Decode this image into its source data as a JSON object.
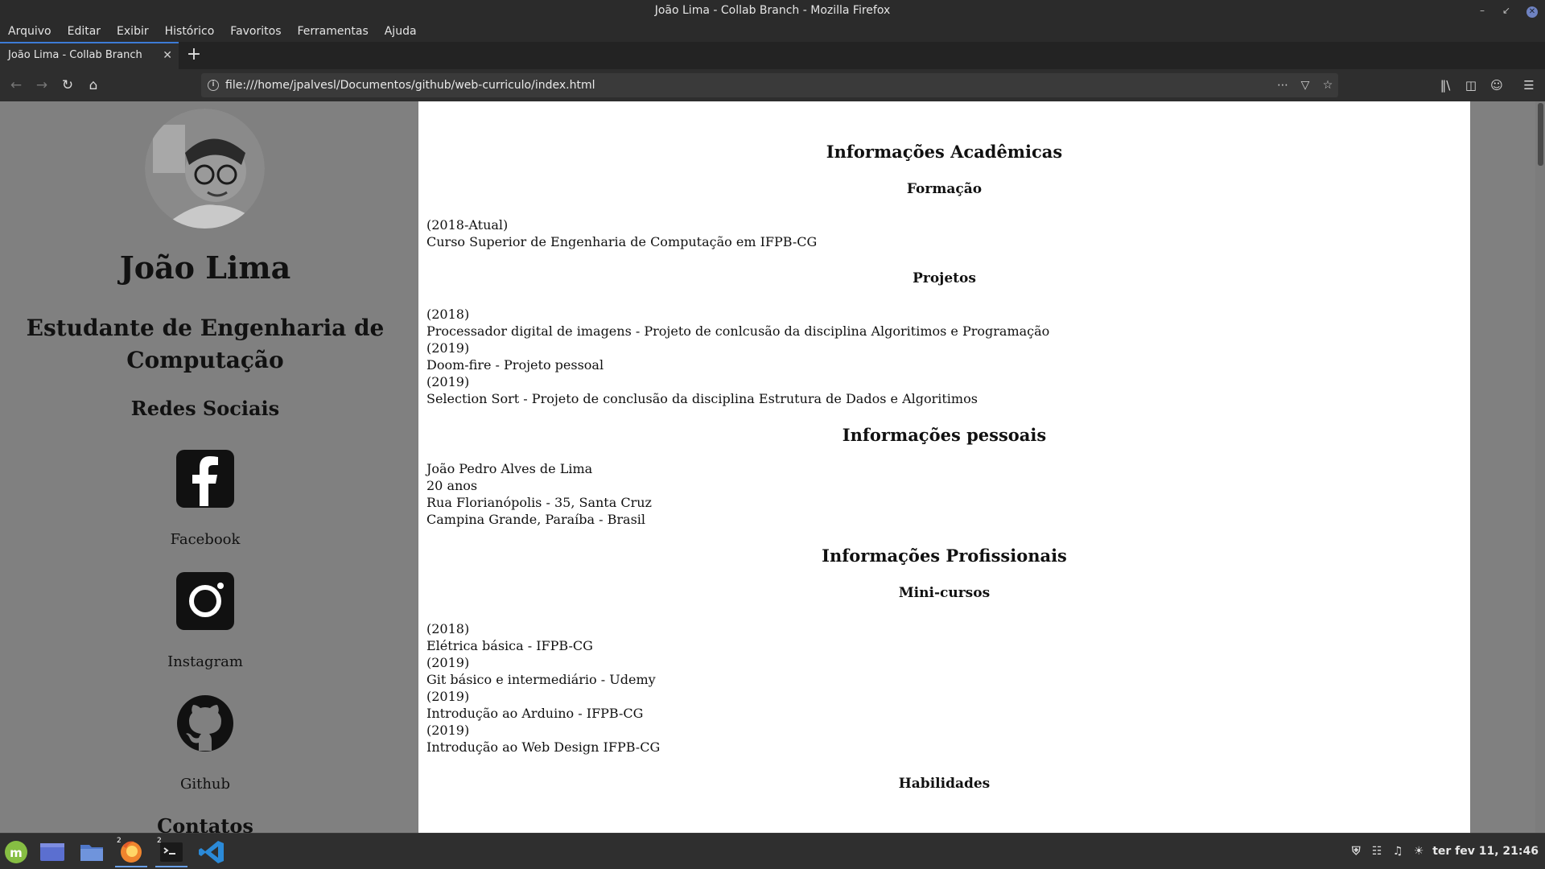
{
  "window": {
    "title": "João Lima - Collab Branch - Mozilla Firefox"
  },
  "menu": [
    "Arquivo",
    "Editar",
    "Exibir",
    "Histórico",
    "Favoritos",
    "Ferramentas",
    "Ajuda"
  ],
  "tab": {
    "title": "João Lima - Collab Branch"
  },
  "url": "file:///home/jpalvesl/Documentos/github/web-curriculo/index.html",
  "sidebar": {
    "name": "João Lima",
    "role": "Estudante de Engenharia de Computação",
    "social_heading": "Redes Sociais",
    "social": [
      {
        "label": "Facebook",
        "icon": "facebook-icon"
      },
      {
        "label": "Instagram",
        "icon": "instagram-icon"
      },
      {
        "label": "Github",
        "icon": "github-icon"
      }
    ],
    "contacts_heading": "Contatos"
  },
  "main": {
    "academic_heading": "Informações Acadêmicas",
    "formation_heading": "Formação",
    "formation": [
      "(2018-Atual)",
      "Curso Superior de Engenharia de Computação em IFPB-CG"
    ],
    "projects_heading": "Projetos",
    "projects": [
      "(2018)",
      "Processador digital de imagens - Projeto de conlcusão da disciplina Algoritimos e Programação",
      "(2019)",
      "Doom-fire - Projeto pessoal",
      "(2019)",
      "Selection Sort - Projeto de conclusão da disciplina Estrutura de Dados e Algoritimos"
    ],
    "personal_heading": "Informações pessoais",
    "personal": [
      "João Pedro Alves de Lima",
      "20 anos",
      "Rua Florianópolis - 35, Santa Cruz",
      "Campina Grande, Paraíba - Brasil"
    ],
    "professional_heading": "Informações Profissionais",
    "courses_heading": "Mini-cursos",
    "courses": [
      "(2018)",
      "Elétrica básica - IFPB-CG",
      "(2019)",
      "Git básico e intermediário - Udemy",
      "(2019)",
      "Introdução ao Arduino - IFPB-CG",
      "(2019)",
      "Introdução ao Web Design IFPB-CG"
    ],
    "skills_heading": "Habilidades"
  },
  "taskbar": {
    "clock": "ter fev 11, 21:46",
    "badges": {
      "firefox": "2",
      "terminal": "2"
    }
  }
}
